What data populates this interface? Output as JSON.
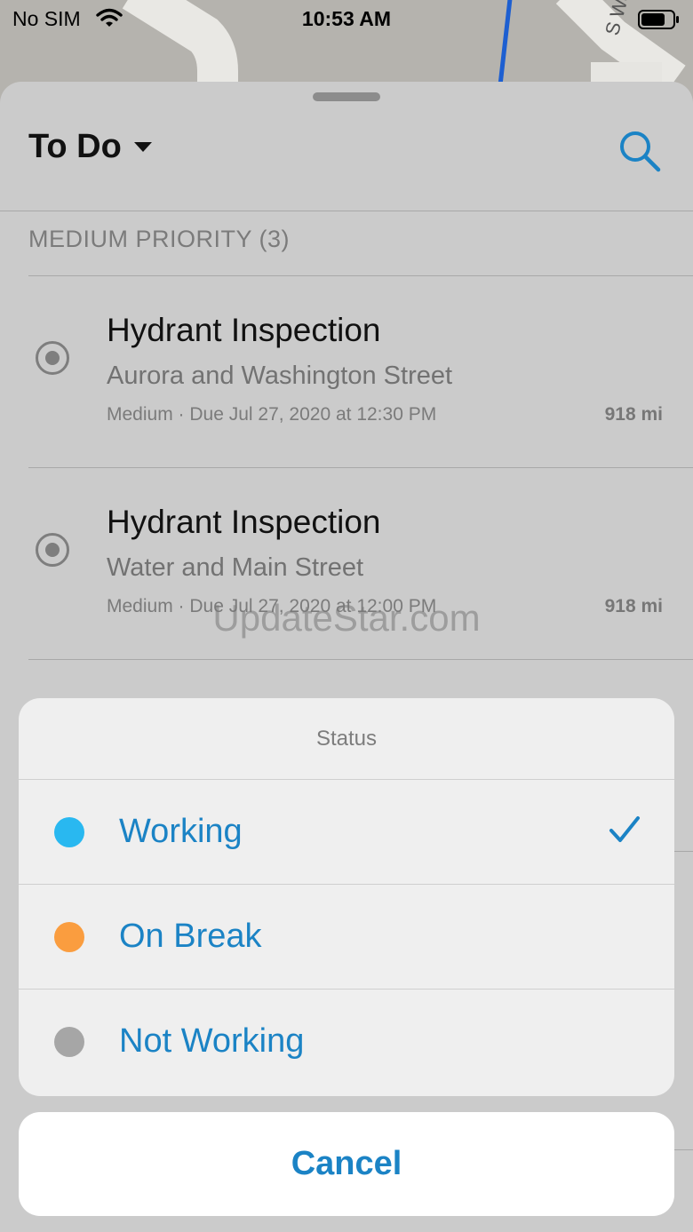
{
  "status_bar": {
    "carrier": "No SIM",
    "time": "10:53 AM",
    "wifi_icon": "wifi-icon",
    "battery_icon": "battery-icon"
  },
  "map": {
    "street_label": "S Was"
  },
  "sheet": {
    "title": "To Do",
    "search_icon": "search-icon",
    "section_header": "MEDIUM PRIORITY (3)",
    "items": [
      {
        "title": "Hydrant Inspection",
        "subtitle": "Aurora and Washington Street",
        "meta": "Medium · Due Jul 27, 2020 at 12:30 PM",
        "distance": "918 mi"
      },
      {
        "title": "Hydrant Inspection",
        "subtitle": "Water and Main Street",
        "meta": "Medium · Due Jul 27, 2020 at 12:00 PM",
        "distance": "918 mi"
      }
    ]
  },
  "watermark": "UpdateStar.com",
  "action_sheet": {
    "title": "Status",
    "options": [
      {
        "label": "Working",
        "color": "#29b8f0",
        "selected": true
      },
      {
        "label": "On Break",
        "color": "#fa9d3f",
        "selected": false
      },
      {
        "label": "Not Working",
        "color": "#a6a6a6",
        "selected": false
      }
    ],
    "cancel_label": "Cancel"
  },
  "colors": {
    "accent": "#1b83c5"
  }
}
